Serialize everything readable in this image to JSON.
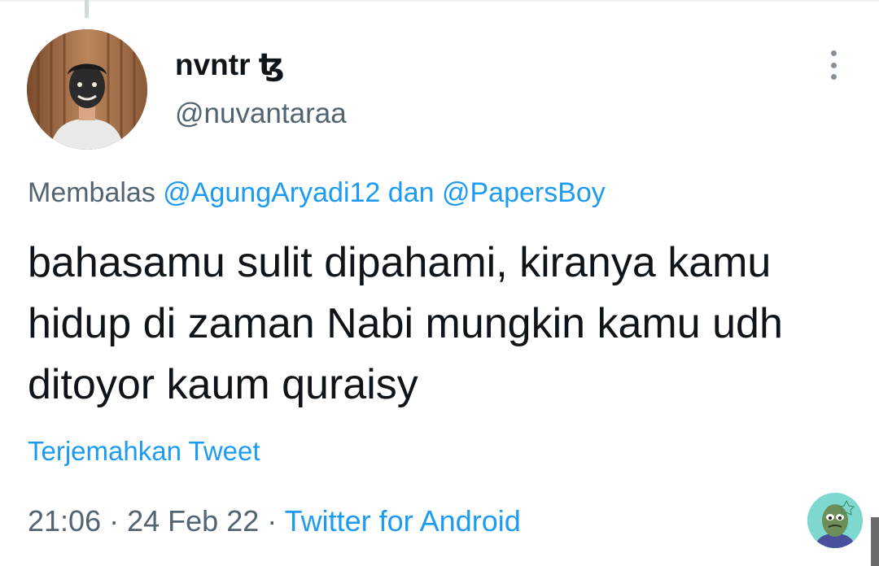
{
  "author": {
    "display_name": "nvntr ꜩ",
    "handle": "@nuvantaraa"
  },
  "reply": {
    "prefix": "Membalas",
    "mention_1": "@AgungAryadi12",
    "conjunction": "dan",
    "mention_2": "@PapersBoy"
  },
  "tweet": {
    "text": "bahasamu sulit dipahami, kiranya kamu hidup di zaman Nabi mungkin kamu udh ditoyor kaum quraisy",
    "translate_label": "Terjemahkan Tweet"
  },
  "meta": {
    "time": "21:06",
    "separator": "·",
    "date": "24 Feb 22",
    "source": "Twitter for Android"
  },
  "icons": {
    "more": "more-vertical-icon"
  },
  "colors": {
    "accent": "#1d9bf0",
    "secondary_text": "#536471",
    "primary_text": "#0f1419"
  }
}
